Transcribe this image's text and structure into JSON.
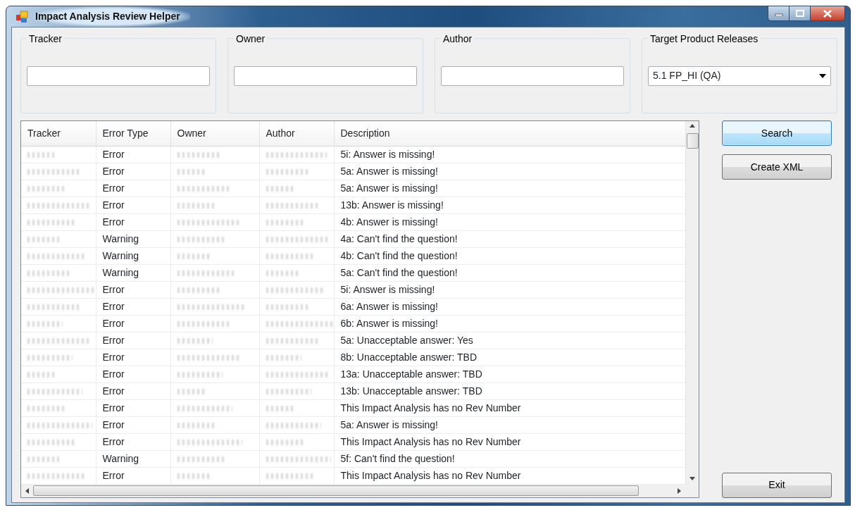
{
  "window": {
    "title": "Impact Analysis Review Helper"
  },
  "filters": [
    {
      "kind": "text",
      "label": "Tracker"
    },
    {
      "kind": "text",
      "label": "Owner"
    },
    {
      "kind": "text",
      "label": "Author"
    },
    {
      "kind": "dropdown",
      "label": "Target Product Releases",
      "value": "5.1 FP_HI (QA)"
    }
  ],
  "table": {
    "columns": [
      "Tracker",
      "Error Type",
      "Owner",
      "Author",
      "Description"
    ],
    "rows": [
      {
        "error_type": "Error",
        "description": "5i: Answer is missing!"
      },
      {
        "error_type": "Error",
        "description": "5a: Answer is missing!"
      },
      {
        "error_type": "Error",
        "description": "5a: Answer is missing!"
      },
      {
        "error_type": "Error",
        "description": "13b: Answer is missing!"
      },
      {
        "error_type": "Error",
        "description": "4b: Answer is missing!"
      },
      {
        "error_type": "Warning",
        "description": "4a: Can't find the question!"
      },
      {
        "error_type": "Warning",
        "description": "4b: Can't find the question!"
      },
      {
        "error_type": "Warning",
        "description": "5a: Can't find the question!"
      },
      {
        "error_type": "Error",
        "description": "5i: Answer is missing!"
      },
      {
        "error_type": "Error",
        "description": "6a: Answer is missing!"
      },
      {
        "error_type": "Error",
        "description": "6b: Answer is missing!"
      },
      {
        "error_type": "Error",
        "description": "5a: Unacceptable answer: Yes"
      },
      {
        "error_type": "Error",
        "description": "8b: Unacceptable answer: TBD"
      },
      {
        "error_type": "Error",
        "description": "13a: Unacceptable answer: TBD"
      },
      {
        "error_type": "Error",
        "description": "13b: Unacceptable answer: TBD"
      },
      {
        "error_type": "Error",
        "description": "This Impact Analysis has no Rev Number"
      },
      {
        "error_type": "Error",
        "description": "5a: Answer is missing!"
      },
      {
        "error_type": "Error",
        "description": "This Impact Analysis has no Rev Number"
      },
      {
        "error_type": "Warning",
        "description": "5f: Can't find the question!"
      },
      {
        "error_type": "Error",
        "description": "This Impact Analysis has no Rev Number"
      }
    ]
  },
  "buttons": [
    {
      "label": "Search",
      "selected": true
    },
    {
      "label": "Create XML",
      "selected": false
    },
    {
      "label": "Exit",
      "selected": false
    }
  ]
}
